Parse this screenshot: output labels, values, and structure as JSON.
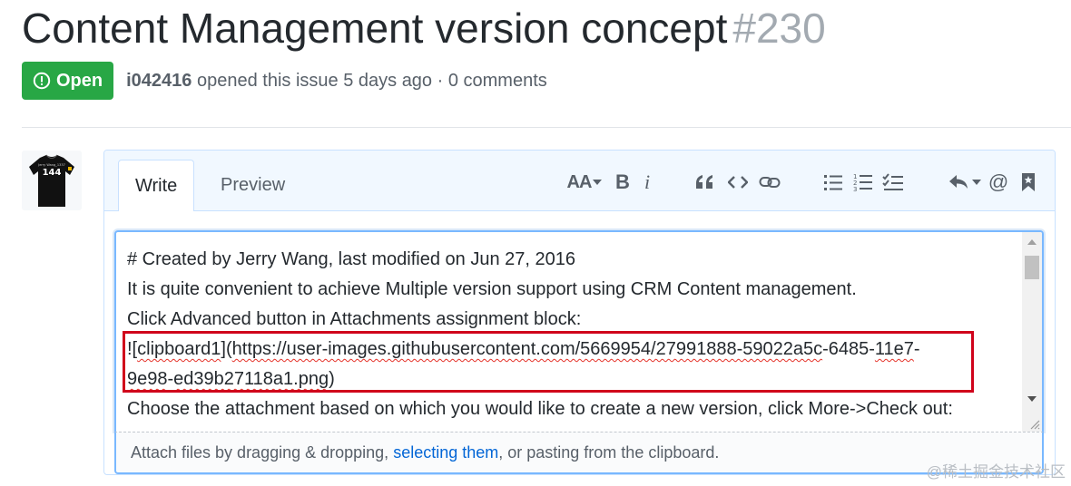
{
  "issue": {
    "title": "Content Management version concept",
    "number": "#230",
    "state_label": "Open",
    "author": "i042416",
    "meta_rest": "opened this issue 5 days ago · 0 comments"
  },
  "avatar": {
    "shirt_text": "144",
    "tiny_text": "Jerry Wang_1337"
  },
  "editor": {
    "tabs": [
      {
        "label": "Write",
        "active": true
      },
      {
        "label": "Preview",
        "active": false
      }
    ],
    "toolbar": [
      {
        "icon": "text-size-icon",
        "label": "AA"
      },
      {
        "icon": "bold-icon",
        "label": "B"
      },
      {
        "icon": "italic-icon",
        "label": "i"
      },
      {
        "icon": "quote-icon"
      },
      {
        "icon": "code-icon"
      },
      {
        "icon": "link-icon"
      },
      {
        "icon": "unordered-list-icon"
      },
      {
        "icon": "ordered-list-icon"
      },
      {
        "icon": "task-list-icon"
      },
      {
        "icon": "reply-icon"
      },
      {
        "icon": "mention-icon",
        "label": "@"
      },
      {
        "icon": "bookmark-icon"
      }
    ],
    "lines": {
      "l1": "# Created by Jerry Wang, last modified on Jun 27, 2016",
      "l2": "It is quite convenient to achieve Multiple version support using CRM Content management.",
      "l3": "Click Advanced button in Attachments assignment block:",
      "l4_a": "![",
      "l4_b": "clipboard1",
      "l4_c": "](",
      "l4_d": "https://user-images.githubusercontent.com/5669954/27991888-59022a5c",
      "l4_e": "-6485-",
      "l4_f": "11e7",
      "l4_g": "-",
      "l5_a": "9e98",
      "l5_b": "-",
      "l5_c": "ed39b27118a1.png",
      "l5_d": ")",
      "l6": "Choose the attachment based on which you would like to create a new version, click More->Check out:"
    },
    "attach": {
      "prefix": "Attach files by dragging & dropping, ",
      "link": "selecting them",
      "suffix": ", or pasting from the clipboard."
    }
  },
  "watermark": "@稀土掘金技术社区",
  "colors": {
    "open_green": "#28a745",
    "link_blue": "#0366d6",
    "focus_border": "#79b8ff",
    "highlight_red": "#d0021b"
  }
}
